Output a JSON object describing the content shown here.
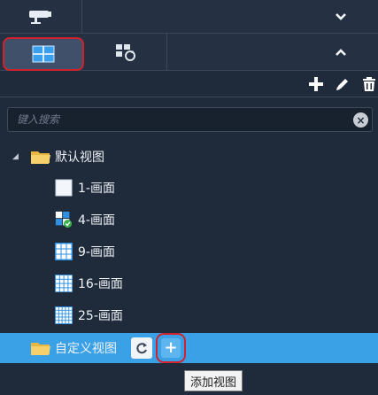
{
  "toolbar": {
    "row1": {
      "left_icon": "camera-icon",
      "right_icon": "chevron-down-icon"
    },
    "row2": {
      "tab1_icon": "grid-view-icon",
      "tab2_icon": "grid-refresh-icon",
      "right_icon": "chevron-up-icon"
    }
  },
  "actions": {
    "add_icon": "plus-icon",
    "edit_icon": "pencil-icon",
    "delete_icon": "trash-icon"
  },
  "search": {
    "placeholder": "键入搜索",
    "value": "",
    "clear_icon": "clear-icon"
  },
  "tree": {
    "default_group": {
      "label": "默认视图",
      "expanded": true
    },
    "items": [
      {
        "label": "1-画面",
        "icon": "single-pane-icon"
      },
      {
        "label": "4-画面",
        "icon": "four-pane-check-icon"
      },
      {
        "label": "9-画面",
        "icon": "nine-pane-icon"
      },
      {
        "label": "16-画面",
        "icon": "sixteen-pane-icon"
      },
      {
        "label": "25-画面",
        "icon": "twentyfive-pane-icon"
      }
    ],
    "custom_group": {
      "label": "自定义视图",
      "refresh_icon": "refresh-icon",
      "add_icon": "add-icon"
    }
  },
  "tooltip": {
    "text": "添加视图"
  },
  "colors": {
    "background": "#1f2a3a",
    "selected": "#3ba1e6",
    "highlight": "#d0222c",
    "pane_blue": "#2f8fe0"
  }
}
